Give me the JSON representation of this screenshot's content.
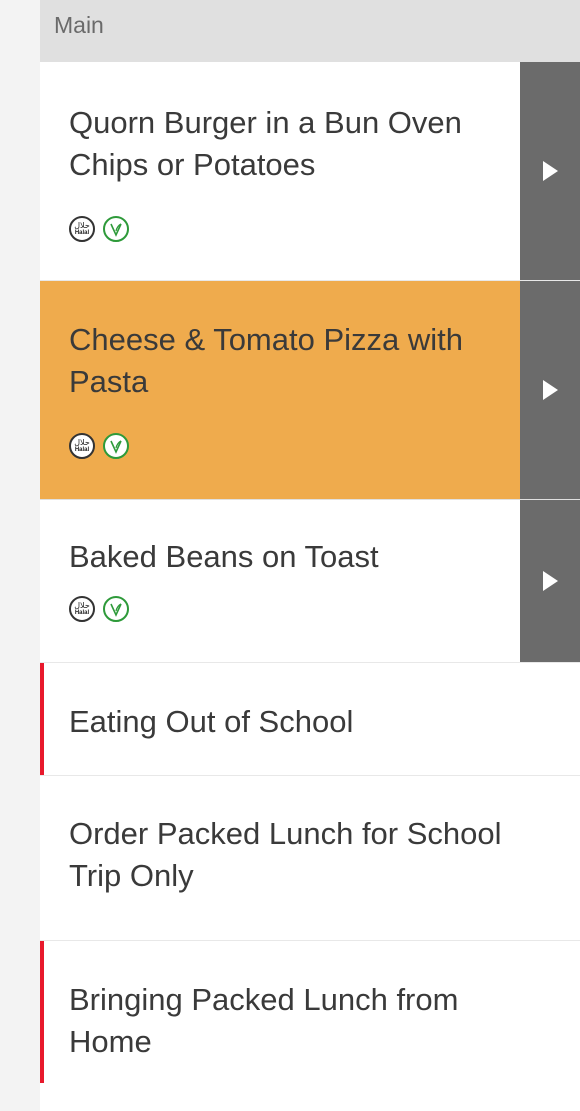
{
  "section": {
    "title": "Main"
  },
  "meals": [
    {
      "name": "Quorn Burger in a Bun Oven Chips or Potatoes",
      "tags": [
        "Halal",
        "Vegetarian"
      ],
      "selected": false
    },
    {
      "name": "Cheese & Tomato Pizza with Pasta",
      "tags": [
        "Halal",
        "Vegetarian"
      ],
      "selected": true
    },
    {
      "name": "Baked Beans on Toast",
      "tags": [
        "Halal",
        "Vegetarian"
      ],
      "selected": false
    }
  ],
  "options": [
    {
      "label": "Eating Out of School",
      "flagged": true
    },
    {
      "label": "Order Packed Lunch for School Trip Only",
      "flagged": false
    },
    {
      "label": "Bringing Packed Lunch from Home",
      "flagged": true
    }
  ],
  "icons": {
    "halal": {
      "name": "halal-icon",
      "text_top": "حلال",
      "text_bottom": "Halal"
    },
    "veg": {
      "name": "vegetarian-icon"
    },
    "arrow": {
      "name": "play-arrow-icon"
    }
  },
  "colors": {
    "selected_bg": "#EFAB4D",
    "arrow_bg": "#6B6B6B",
    "header_bg": "#E0E0E0",
    "flag": "#E8192C",
    "veg_green": "#2E9A3A"
  }
}
